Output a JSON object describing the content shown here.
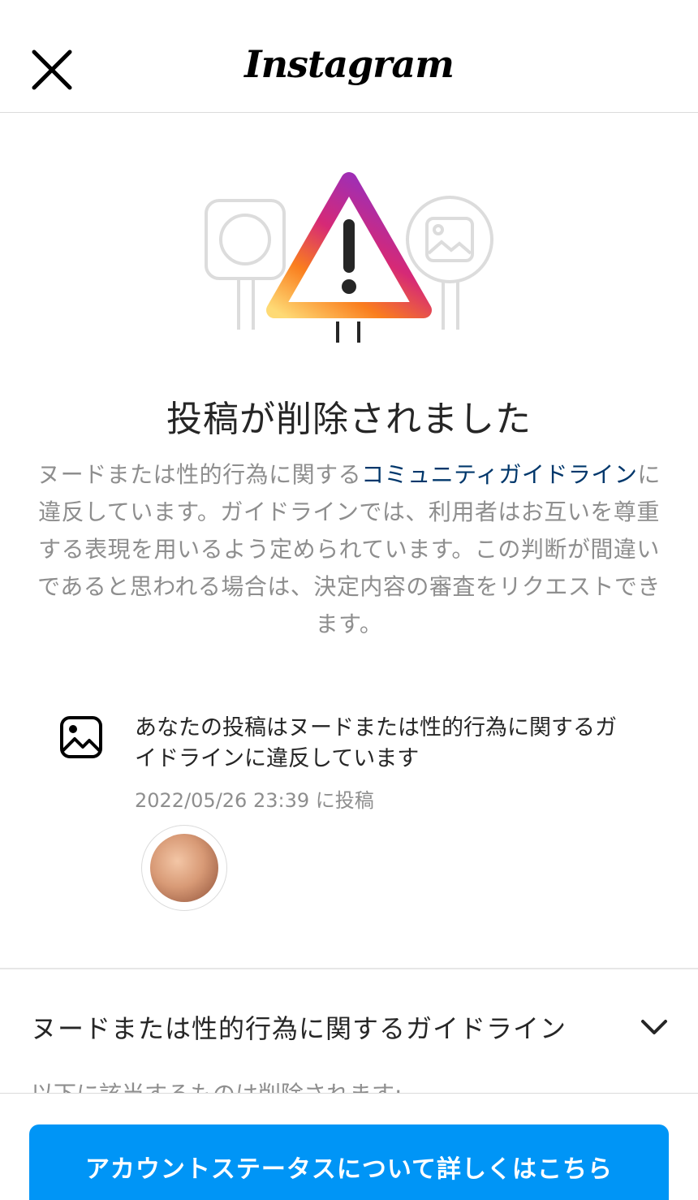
{
  "header": {
    "app_name": "Instagram",
    "close_icon": "close-icon"
  },
  "main": {
    "title": "投稿が削除されました",
    "description_before": "ヌードまたは性的行為に関する",
    "description_link": "コミュニティガイドライン",
    "description_after": "に違反しています。ガイドラインでは、利用者はお互いを尊重する表現を用いるよう定められています。この判断が間違いであると思われる場合は、決定内容の審査をリクエストできます。",
    "link_color": "#00376b"
  },
  "post": {
    "icon": "image-icon",
    "message": "あなたの投稿はヌードまたは性的行為に関するガイドラインに違反しています",
    "posted_at": "2022/05/26 23:39 に投稿"
  },
  "accordion": {
    "label": "ヌードまたは性的行為に関するガイドライン",
    "icon": "chevron-down-icon",
    "partial_text": "以下に該当するものは削除されます:"
  },
  "footer": {
    "button_label": "アカウントステータスについて詳しくはこちら",
    "button_color": "#0095f6"
  }
}
